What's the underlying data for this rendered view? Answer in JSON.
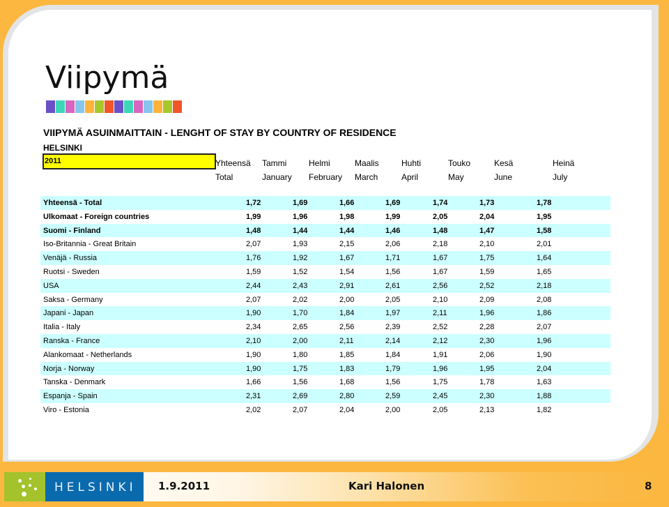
{
  "slide": {
    "title": "Viipymä",
    "swatch_colors": [
      "#6b50c8",
      "#3fd6b8",
      "#d865c0",
      "#86c6ec",
      "#fdb33b",
      "#a8c72c",
      "#f0562a",
      "#6b50c8",
      "#3fd6b8",
      "#d865c0",
      "#86c6ec",
      "#fdb33b",
      "#a8c72c",
      "#f0562a"
    ],
    "subtitle": "VIIPYMÄ ASUINMAITTAIN  - LENGHT OF STAY BY COUNTRY OF RESIDENCE",
    "city": "HELSINKI",
    "year": "2011",
    "accent_color": "#fbb73f",
    "row_shade_color": "#ccffff"
  },
  "table": {
    "headers_fi": [
      "Yhteensä",
      "Tammi",
      "Helmi",
      "Maalis",
      "Huhti",
      "Touko",
      "Kesä",
      "Heinä"
    ],
    "headers_en": [
      "Total",
      "January",
      "February",
      "March",
      "April",
      "May",
      "June",
      "July"
    ],
    "rows": [
      {
        "label": "Yhteensä - Total",
        "values": [
          "1,72",
          "1,69",
          "1,66",
          "1,69",
          "1,74",
          "1,73",
          "1,78"
        ],
        "bold": true,
        "shade": true
      },
      {
        "label": "Ulkomaat - Foreign countries",
        "values": [
          "1,99",
          "1,96",
          "1,98",
          "1,99",
          "2,05",
          "2,04",
          "1,95"
        ],
        "bold": true,
        "shade": false
      },
      {
        "label": "Suomi - Finland",
        "values": [
          "1,48",
          "1,44",
          "1,44",
          "1,46",
          "1,48",
          "1,47",
          "1,58"
        ],
        "bold": true,
        "shade": true
      },
      {
        "label": "Iso-Britannia - Great Britain",
        "values": [
          "2,07",
          "1,93",
          "2,15",
          "2,06",
          "2,18",
          "2,10",
          "2,01"
        ],
        "bold": false,
        "shade": false
      },
      {
        "label": "Venäjä - Russia",
        "values": [
          "1,76",
          "1,92",
          "1,67",
          "1,71",
          "1,67",
          "1,75",
          "1,64"
        ],
        "bold": false,
        "shade": true
      },
      {
        "label": "Ruotsi - Sweden",
        "values": [
          "1,59",
          "1,52",
          "1,54",
          "1,56",
          "1,67",
          "1,59",
          "1,65"
        ],
        "bold": false,
        "shade": false
      },
      {
        "label": "USA",
        "values": [
          "2,44",
          "2,43",
          "2,91",
          "2,61",
          "2,56",
          "2,52",
          "2,18"
        ],
        "bold": false,
        "shade": true
      },
      {
        "label": "Saksa - Germany",
        "values": [
          "2,07",
          "2,02",
          "2,00",
          "2,05",
          "2,10",
          "2,09",
          "2,08"
        ],
        "bold": false,
        "shade": false
      },
      {
        "label": "Japani - Japan",
        "values": [
          "1,90",
          "1,70",
          "1,84",
          "1,97",
          "2,11",
          "1,96",
          "1,86"
        ],
        "bold": false,
        "shade": true
      },
      {
        "label": "Italia - Italy",
        "values": [
          "2,34",
          "2,65",
          "2,56",
          "2,39",
          "2,52",
          "2,28",
          "2,07"
        ],
        "bold": false,
        "shade": false
      },
      {
        "label": "Ranska - France",
        "values": [
          "2,10",
          "2,00",
          "2,11",
          "2,14",
          "2,12",
          "2,30",
          "1,96"
        ],
        "bold": false,
        "shade": true
      },
      {
        "label": "Alankomaat - Netherlands",
        "values": [
          "1,90",
          "1,80",
          "1,85",
          "1,84",
          "1,91",
          "2,06",
          "1,90"
        ],
        "bold": false,
        "shade": false
      },
      {
        "label": "Norja - Norway",
        "values": [
          "1,90",
          "1,75",
          "1,83",
          "1,79",
          "1,96",
          "1,95",
          "2,04"
        ],
        "bold": false,
        "shade": true
      },
      {
        "label": "Tanska - Denmark",
        "values": [
          "1,66",
          "1,56",
          "1,68",
          "1,56",
          "1,75",
          "1,78",
          "1,63"
        ],
        "bold": false,
        "shade": false
      },
      {
        "label": "Espanja - Spain",
        "values": [
          "2,31",
          "2,69",
          "2,80",
          "2,59",
          "2,45",
          "2,30",
          "1,88"
        ],
        "bold": false,
        "shade": true
      },
      {
        "label": "Viro - Estonia",
        "values": [
          "2,02",
          "2,07",
          "2,04",
          "2,00",
          "2,05",
          "2,13",
          "1,82"
        ],
        "bold": false,
        "shade": false
      }
    ]
  },
  "footer": {
    "logo_text": "HELSINKI",
    "date": "1.9.2011",
    "author": "Kari Halonen",
    "page_number": "8"
  }
}
